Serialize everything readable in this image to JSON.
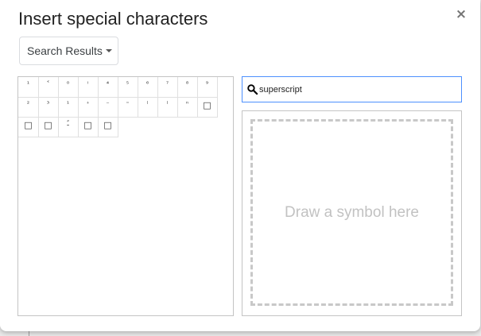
{
  "dialog": {
    "title": "Insert special characters",
    "close_label": "×"
  },
  "category_dropdown": {
    "selected": "Search Results"
  },
  "search": {
    "value": "superscript",
    "placeholder": ""
  },
  "draw_area": {
    "hint": "Draw a symbol here"
  },
  "characters": [
    {
      "char": "¹",
      "cls": ""
    },
    {
      "char": "˂",
      "cls": ""
    },
    {
      "char": "⁰",
      "cls": ""
    },
    {
      "char": "ⁱ",
      "cls": ""
    },
    {
      "char": "⁴",
      "cls": ""
    },
    {
      "char": "⁵",
      "cls": ""
    },
    {
      "char": "⁶",
      "cls": ""
    },
    {
      "char": "⁷",
      "cls": ""
    },
    {
      "char": "⁸",
      "cls": ""
    },
    {
      "char": "⁹",
      "cls": ""
    },
    {
      "char": "²",
      "cls": ""
    },
    {
      "char": "³",
      "cls": ""
    },
    {
      "char": "¹",
      "cls": ""
    },
    {
      "char": "⁺",
      "cls": ""
    },
    {
      "char": "⁻",
      "cls": ""
    },
    {
      "char": "⁼",
      "cls": ""
    },
    {
      "char": "⁽",
      "cls": ""
    },
    {
      "char": "⁾",
      "cls": ""
    },
    {
      "char": "ⁿ",
      "cls": ""
    },
    {
      "char": "□",
      "cls": "box"
    },
    {
      "char": "□",
      "cls": "box"
    },
    {
      "char": "□",
      "cls": "box"
    },
    {
      "char": "ﹱ",
      "cls": ""
    },
    {
      "char": "□",
      "cls": "box"
    },
    {
      "char": "□",
      "cls": "box"
    }
  ]
}
